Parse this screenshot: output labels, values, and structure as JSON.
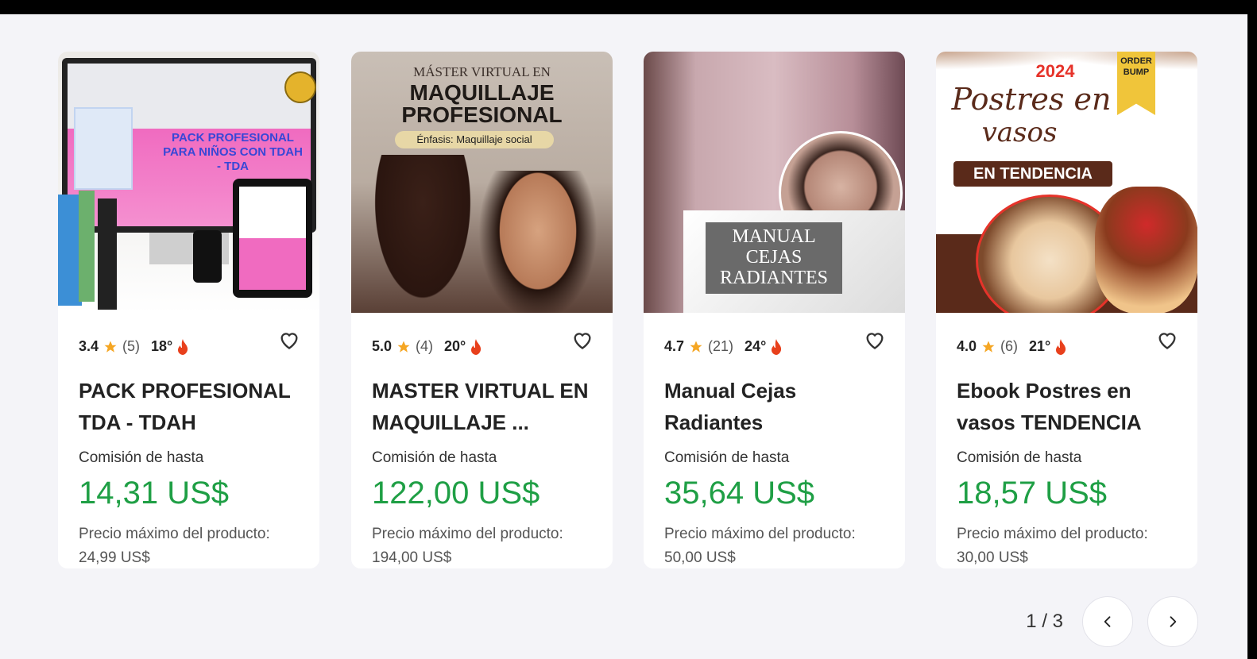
{
  "cards": [
    {
      "rating": "3.4",
      "reviews": "(5)",
      "heat": "18°",
      "title": "PACK PROFESIONAL TDA - TDAH",
      "commission_label": "Comisión de hasta",
      "commission": "14,31 US$",
      "price_label": "Precio máximo del producto:",
      "price": "24,99 US$",
      "image_text": [
        "PACK PROFESIONAL PARA NIÑOS CON TDAH - TDA"
      ]
    },
    {
      "rating": "5.0",
      "reviews": "(4)",
      "heat": "20°",
      "title": "MASTER VIRTUAL EN MAQUILLAJE ...",
      "commission_label": "Comisión de hasta",
      "commission": "122,00 US$",
      "price_label": "Precio máximo del producto:",
      "price": "194,00 US$",
      "image_text": [
        "MÁSTER VIRTUAL EN",
        "MAQUILLAJE",
        "PROFESIONAL",
        "Énfasis: Maquillaje social"
      ]
    },
    {
      "rating": "4.7",
      "reviews": "(21)",
      "heat": "24°",
      "title": "Manual Cejas Radiantes",
      "commission_label": "Comisión de hasta",
      "commission": "35,64 US$",
      "price_label": "Precio máximo del producto:",
      "price": "50,00 US$",
      "image_text": [
        "MANUAL",
        "CEJAS",
        "RADIANTES"
      ]
    },
    {
      "rating": "4.0",
      "reviews": "(6)",
      "heat": "21°",
      "title": "Ebook Postres en vasos TENDENCIA",
      "commission_label": "Comisión de hasta",
      "commission": "18,57 US$",
      "price_label": "Precio máximo del producto:",
      "price": "30,00 US$",
      "image_text": [
        "2024",
        "Postres en",
        "vasos",
        "EN TENDENCIA",
        "ORDER",
        "BUMP"
      ]
    }
  ],
  "pager": {
    "count": "1 / 3"
  },
  "colors": {
    "commission": "#1f9f45",
    "star": "#f5a623",
    "flame": "#e8401c"
  },
  "icons": [
    "star-icon",
    "flame-icon",
    "heart-icon",
    "chevron-left-icon",
    "chevron-right-icon"
  ]
}
